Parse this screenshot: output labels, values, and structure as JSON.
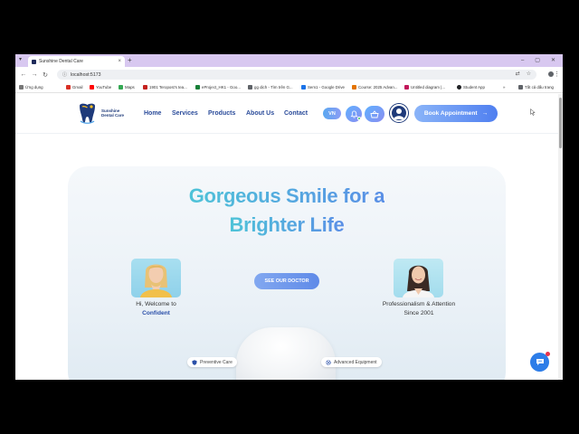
{
  "browser": {
    "tab_title": "Sunshine Dental Care",
    "url": "localhost:5173",
    "bookmarks": [
      {
        "label": "Ứng dụng",
        "color": "#4a4a4a"
      },
      {
        "label": "Gmail",
        "color": "#d93025"
      },
      {
        "label": "YouTube",
        "color": "#ff0000"
      },
      {
        "label": "Maps",
        "color": "#34a853"
      },
      {
        "label": "1901 Teropost's tea...",
        "color": "#c5221f"
      },
      {
        "label": "eProject_HK1 - Goo...",
        "color": "#188038"
      },
      {
        "label": "gg dịch - Tìm trên G...",
        "color": "#5f6368"
      },
      {
        "label": "Sem1 - Google Drive",
        "color": "#1a73e8"
      },
      {
        "label": "Course: 2025 Advan...",
        "color": "#e37400"
      },
      {
        "label": "Untitled diagram |...",
        "color": "#c2185b"
      },
      {
        "label": "Student App",
        "color": "#202124"
      }
    ],
    "bookmarks_more": "»",
    "all_bookmarks": "Tất cả dấu trang"
  },
  "header": {
    "brand": "Sunshine Dental Care",
    "nav": [
      "Home",
      "Services",
      "Products",
      "About Us",
      "Contact"
    ],
    "lang": "VN",
    "cta": "Book Appointment"
  },
  "hero": {
    "title_part1": "Gorgeous Smile for a",
    "title_part2": "Brighter Life",
    "left_caption_line1": "Hi, Welcome to",
    "left_caption_highlight": "Confident",
    "see_doctor": "SEE OUR DOCTOR",
    "right_caption_line1": "Professionalism & Attention",
    "right_caption_line2": "Since 2001",
    "chip_left": "Preventive Care",
    "chip_right": "Advanced Equipment"
  },
  "icons": {
    "bell": "bell-icon",
    "cart": "basket-icon",
    "chat": "chat-icon"
  },
  "colors": {
    "brand_blue": "#2a4b9a",
    "accent_gradient_start": "#4fc3d8",
    "accent_gradient_end": "#5a8fe6",
    "cta": "#4f7ff0"
  }
}
